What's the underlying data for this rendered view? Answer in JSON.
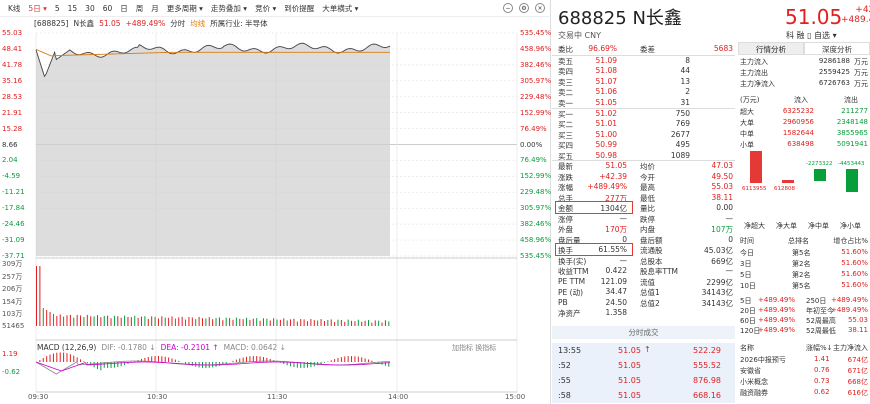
{
  "toolbar": {
    "items": [
      "K线",
      "5日 ▾",
      "5",
      "15",
      "30",
      "60",
      "日",
      "周",
      "月",
      "更多周期 ▾",
      "走势叠加 ▾",
      "竞价 ▾",
      "到价提醒",
      "大单横式 ▾"
    ],
    "selected_index": 1
  },
  "chart_header": {
    "code": "[688825]",
    "name": "N长鑫",
    "price": "51.05",
    "pct": "+489.49%",
    "mode": "分时",
    "avg": "均线",
    "industry": "所属行业: 半导体"
  },
  "price_axis": {
    "left": [
      "55.03",
      "48.41",
      "41.78",
      "35.16",
      "28.53",
      "21.91",
      "15.28",
      "8.66",
      "2.04",
      "-4.59",
      "-11.21",
      "-17.84",
      "-24.46",
      "-31.09",
      "-37.71"
    ],
    "right": [
      "535.45%",
      "458.96%",
      "382.46%",
      "305.97%",
      "229.48%",
      "152.99%",
      "76.49%",
      "0.00%",
      "76.49%",
      "152.99%",
      "229.48%",
      "305.97%",
      "382.46%",
      "458.96%",
      "535.45%"
    ]
  },
  "volume_axis": [
    "309万",
    "257万",
    "206万",
    "154万",
    "103万",
    "51465"
  ],
  "macd": {
    "name": "MACD (12,26,9)",
    "dif": "DIF: -0.1780 ↓",
    "dea": "DEA: -0.2101 ↑",
    "macd": "MACD: 0.0642 ↓",
    "tools": "加指标  换指标",
    "axis": [
      "1.19",
      "-0.62"
    ]
  },
  "times": [
    "09:30",
    "10:30",
    "11:30",
    "14:00",
    "15:00"
  ],
  "stock": {
    "code": "688825",
    "name": "N长鑫",
    "price": "51.05",
    "change": "+42.39",
    "pct": "+489.49%",
    "status": "交易中 CNY",
    "btns": "科  融  ▯  自选 ▾"
  },
  "orderbook": {
    "weibi": {
      "l1": "委比",
      "v1": "96.69%",
      "l2": "委差",
      "v2": "5683"
    },
    "asks": [
      {
        "l": "卖五",
        "p": "51.09",
        "v": "8"
      },
      {
        "l": "卖四",
        "p": "51.08",
        "v": "44"
      },
      {
        "l": "卖三",
        "p": "51.07",
        "v": "13"
      },
      {
        "l": "卖二",
        "p": "51.06",
        "v": "2"
      },
      {
        "l": "卖一",
        "p": "51.05",
        "v": "31"
      }
    ],
    "bids": [
      {
        "l": "买一",
        "p": "51.02",
        "v": "750"
      },
      {
        "l": "买二",
        "p": "51.01",
        "v": "769"
      },
      {
        "l": "买三",
        "p": "51.00",
        "v": "2677"
      },
      {
        "l": "买四",
        "p": "50.99",
        "v": "495"
      },
      {
        "l": "买五",
        "p": "50.98",
        "v": "1089"
      }
    ],
    "stats": [
      {
        "l1": "最新",
        "v1": "51.05",
        "l2": "均价",
        "v2": "47.03"
      },
      {
        "l1": "涨跌",
        "v1": "+42.39",
        "l2": "今开",
        "v2": "49.50"
      },
      {
        "l1": "涨幅",
        "v1": "+489.49%",
        "l2": "最高",
        "v2": "55.03"
      },
      {
        "l1": "总手",
        "v1": "277万",
        "l2": "最低",
        "v2": "38.11"
      },
      {
        "l1": "金额",
        "v1": "1304亿",
        "l2": "量比",
        "v2": "0.00"
      },
      {
        "l1": "涨停",
        "v1": "—",
        "l2": "跌停",
        "v2": "—"
      },
      {
        "l1": "外盘",
        "v1": "170万",
        "l2": "内盘",
        "v2": "107万"
      },
      {
        "l1": "盘后量",
        "v1": "0",
        "l2": "盘后额",
        "v2": "0"
      },
      {
        "l1": "换手",
        "v1": "61.55%",
        "l2": "流通股",
        "v2": "45.03亿"
      },
      {
        "l1": "换手(实)",
        "v1": "—",
        "l2": "总股本",
        "v2": "669亿"
      },
      {
        "l1": "收益TTM",
        "v1": "0.422",
        "l2": "股息率TTM",
        "v2": "—"
      },
      {
        "l1": "PE TTM",
        "v1": "121.09",
        "l2": "流值",
        "v2": "2299亿"
      },
      {
        "l1": "PE (动)",
        "v1": "34.47",
        "l2": "总值1",
        "v2": "34143亿"
      },
      {
        "l1": "PB",
        "v1": "24.50",
        "l2": "总值2",
        "v2": "34143亿"
      },
      {
        "l1": "净资产",
        "v1": "1.358",
        "l2": "",
        "v2": ""
      }
    ]
  },
  "ticks_head": "分时成交",
  "ticks": [
    {
      "t": "13:55",
      "p": "51.05",
      "a": "↑",
      "v": "522.29"
    },
    {
      "t": ":52",
      "p": "51.05",
      "a": "",
      "v": "555.52"
    },
    {
      "t": ":55",
      "p": "51.05",
      "a": "",
      "v": "876.98"
    },
    {
      "t": ":58",
      "p": "51.05",
      "a": "",
      "v": "668.16"
    }
  ],
  "panel": {
    "tabs": [
      "行情分析",
      "深度分析"
    ],
    "flows": [
      {
        "l": "主力流入",
        "v": "9286188",
        "u": "万元"
      },
      {
        "l": "主力流出",
        "v": "2559425",
        "u": "万元"
      },
      {
        "l": "主力净流入",
        "v": "6726763",
        "u": "万元"
      }
    ],
    "flow_head": {
      "c0": "(万元)",
      "c1": "流入",
      "c2": "流出"
    },
    "flow_rows": [
      {
        "l": "超大",
        "in": "6325232",
        "out": "211277"
      },
      {
        "l": "大单",
        "in": "2960956",
        "out": "2348148"
      },
      {
        "l": "中单",
        "in": "1582644",
        "out": "3855965"
      },
      {
        "l": "小单",
        "in": "638498",
        "out": "5091941"
      }
    ],
    "bars": [
      {
        "cat": "净超大",
        "label": "6113955",
        "value": 6113955
      },
      {
        "cat": "净大单",
        "label": "612808",
        "value": 612808
      },
      {
        "cat": "净中单",
        "label": "-2273322",
        "value": -2273322
      },
      {
        "cat": "净小单",
        "label": "-4453443",
        "value": -4453443
      }
    ],
    "rank_head": {
      "c0": "时间",
      "c1": "总排名",
      "c2": "增仓占比%"
    },
    "rank_rows": [
      {
        "l": "今日",
        "r": "第5名",
        "v": "51.60%"
      },
      {
        "l": "3日",
        "r": "第2名",
        "v": "51.60%"
      },
      {
        "l": "5日",
        "r": "第2名",
        "v": "51.60%"
      },
      {
        "l": "10日",
        "r": "第5名",
        "v": "51.60%"
      }
    ],
    "perf": [
      {
        "a": "5日",
        "b": "+489.49%",
        "c": "250日",
        "d": "+489.49%"
      },
      {
        "a": "20日",
        "b": "+489.49%",
        "c": "年初至今",
        "d": "+489.49%"
      },
      {
        "a": "60日",
        "b": "+489.49%",
        "c": "52周最高",
        "d": "55.03"
      },
      {
        "a": "120日",
        "b": "+489.49%",
        "c": "52周最低",
        "d": "38.11"
      }
    ],
    "sector_head": {
      "c0": "名称",
      "c1": "涨幅%↓",
      "c2": "主力净流入"
    },
    "sectors": [
      {
        "n": "2026中报预亏",
        "p": "1.41",
        "f": "674亿"
      },
      {
        "n": "安徽省",
        "p": "0.76",
        "f": "671亿"
      },
      {
        "n": "小米概念",
        "p": "0.73",
        "f": "668亿"
      },
      {
        "n": "融资融券",
        "p": "0.62",
        "f": "616亿"
      }
    ]
  },
  "colors": {
    "up": "#e02020",
    "down": "#089e3a",
    "line": "#333333",
    "avg": "#e07a10",
    "highlight": "#e53935"
  }
}
